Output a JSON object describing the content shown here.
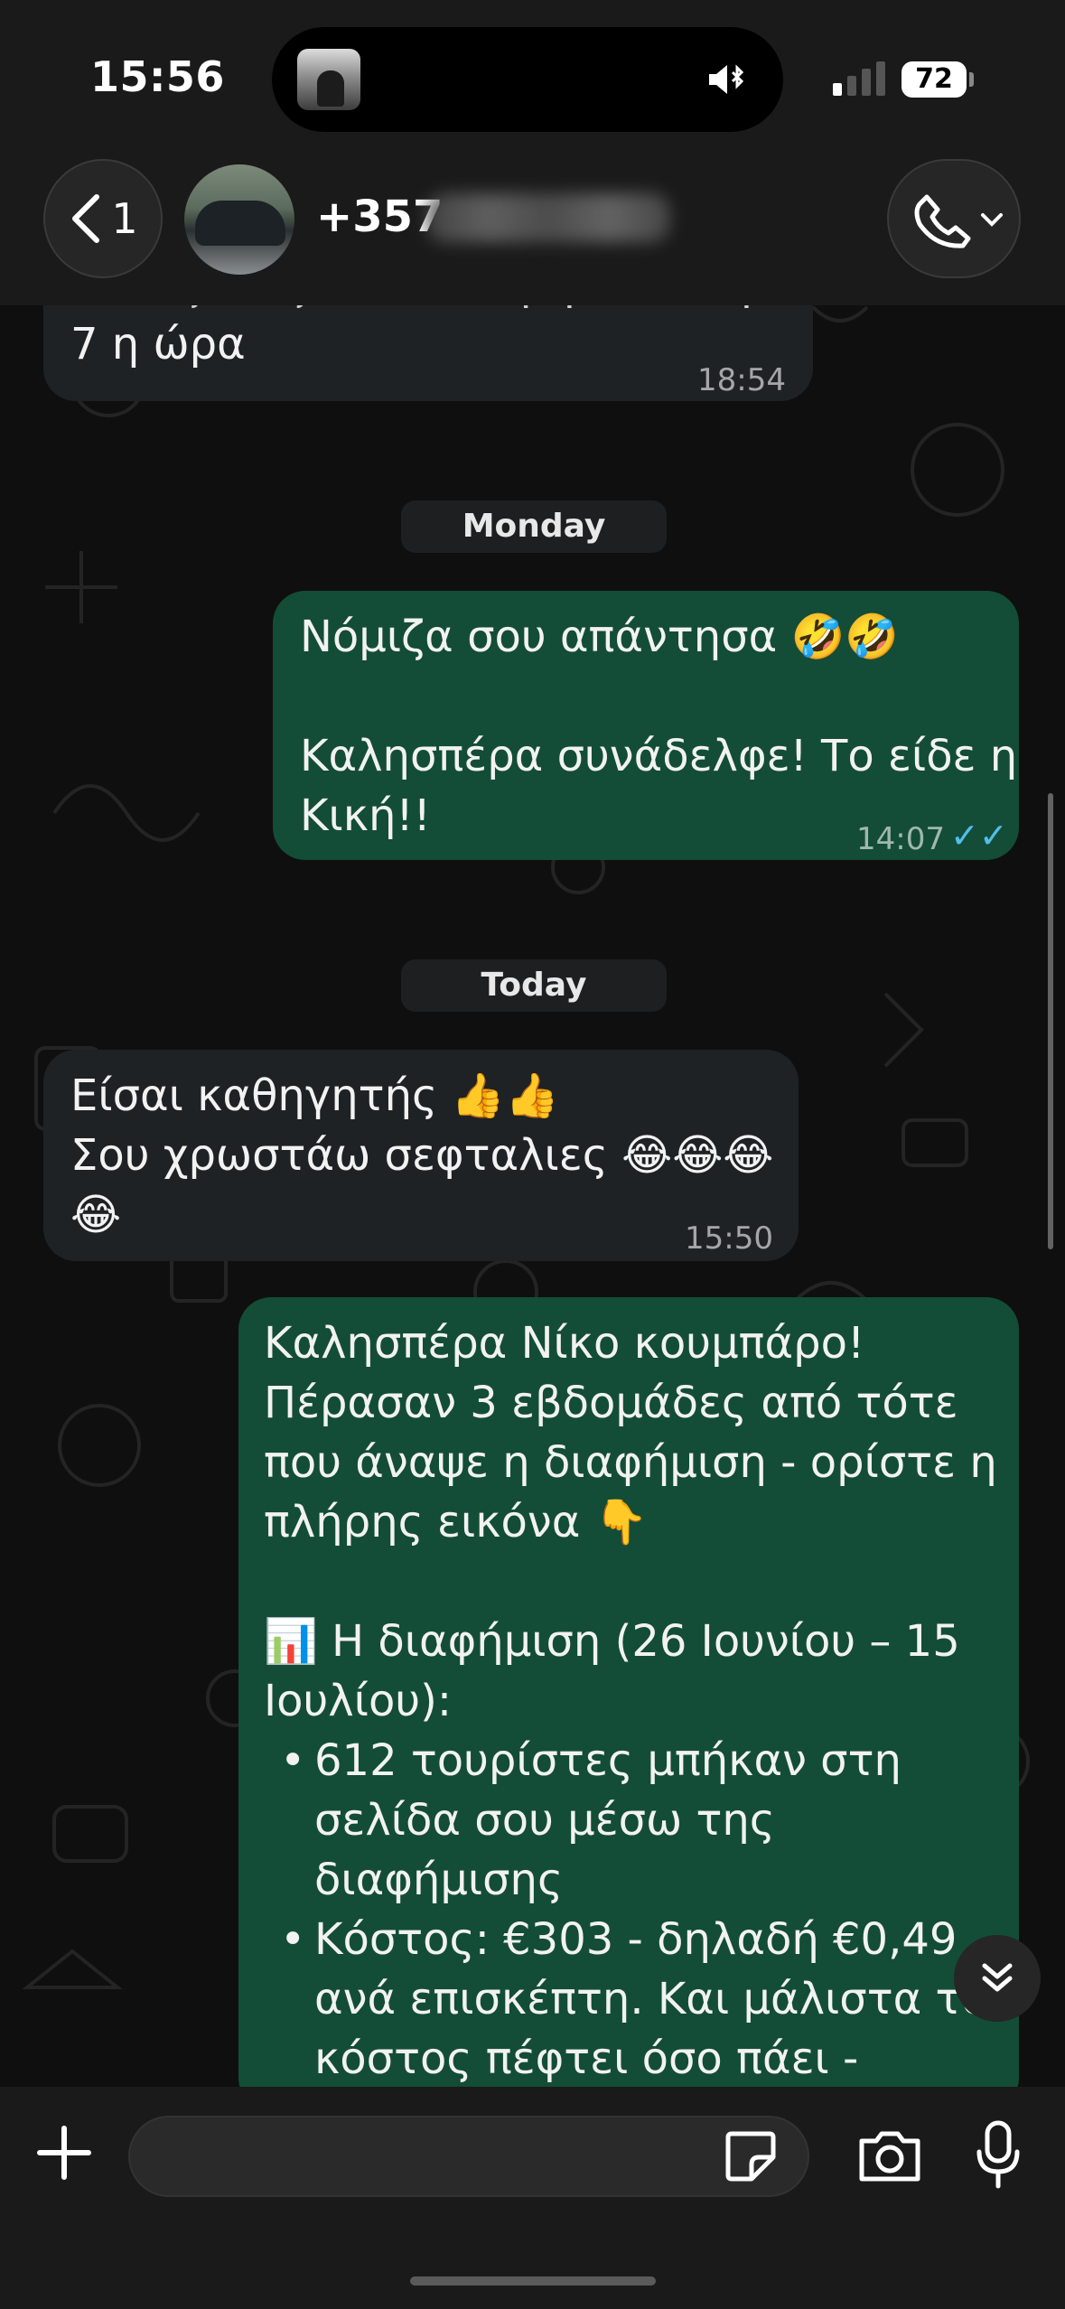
{
  "status_bar": {
    "time": "15:56",
    "battery": "72"
  },
  "header": {
    "back_count": "1",
    "contact_name": "+357"
  },
  "messages": [
    {
      "id": "m0",
      "direction": "incoming",
      "lines": [
        "Αυτος 'κας' τα καταφερο και οραλο",
        "7 η ώρα"
      ],
      "time": "18:54"
    },
    {
      "id": "d1",
      "type": "day",
      "label": "Monday"
    },
    {
      "id": "m1",
      "direction": "outgoing",
      "lines": [
        "Νόμιζα σου απάντησα 🤣🤣",
        "",
        "Καλησπέρα συνάδελφε! Το είδε η",
        "Κική!!"
      ],
      "time": "14:07",
      "status": "read"
    },
    {
      "id": "d2",
      "type": "day",
      "label": "Today"
    },
    {
      "id": "m2",
      "direction": "incoming",
      "lines": [
        "Είσαι καθηγητής 👍👍",
        "Σου χρωστάω σεφταλιες 😂😂😂",
        "😂"
      ],
      "time": "15:50"
    },
    {
      "id": "m3",
      "direction": "outgoing",
      "lines": [
        "Καλησπέρα Νίκο κουμπάρο!",
        "Πέρασαν 3 εβδομάδες από τότε",
        "που άναψε η διαφήμιση - ορίστε η",
        "πλήρης εικόνα 👇",
        "",
        "📊 Η διαφήμιση (26 Ιουνίου – 15",
        "Ιουλίου):"
      ],
      "bullets": [
        [
          "612 τουρίστες μπήκαν στη",
          "σελίδα σου μέσω της",
          "διαφήμισης"
        ],
        [
          "Κόστος: €303 - δηλαδή €0,49",
          "ανά επισκέπτη. Και μάλιστα το",
          "κόστος πέφτει όσο πάει -"
        ]
      ]
    }
  ],
  "composer": {
    "placeholder": ""
  },
  "icons": {
    "back": "chevron-left-icon",
    "call": "phone-icon",
    "plus": "plus-icon",
    "sticker": "sticker-icon",
    "camera": "camera-icon",
    "mic": "microphone-icon",
    "scroll_down": "double-chevron-down-icon"
  },
  "colors": {
    "incoming_bubble": "#1f2224",
    "outgoing_bubble": "#134d37",
    "read_ticks": "#53bdeb"
  }
}
